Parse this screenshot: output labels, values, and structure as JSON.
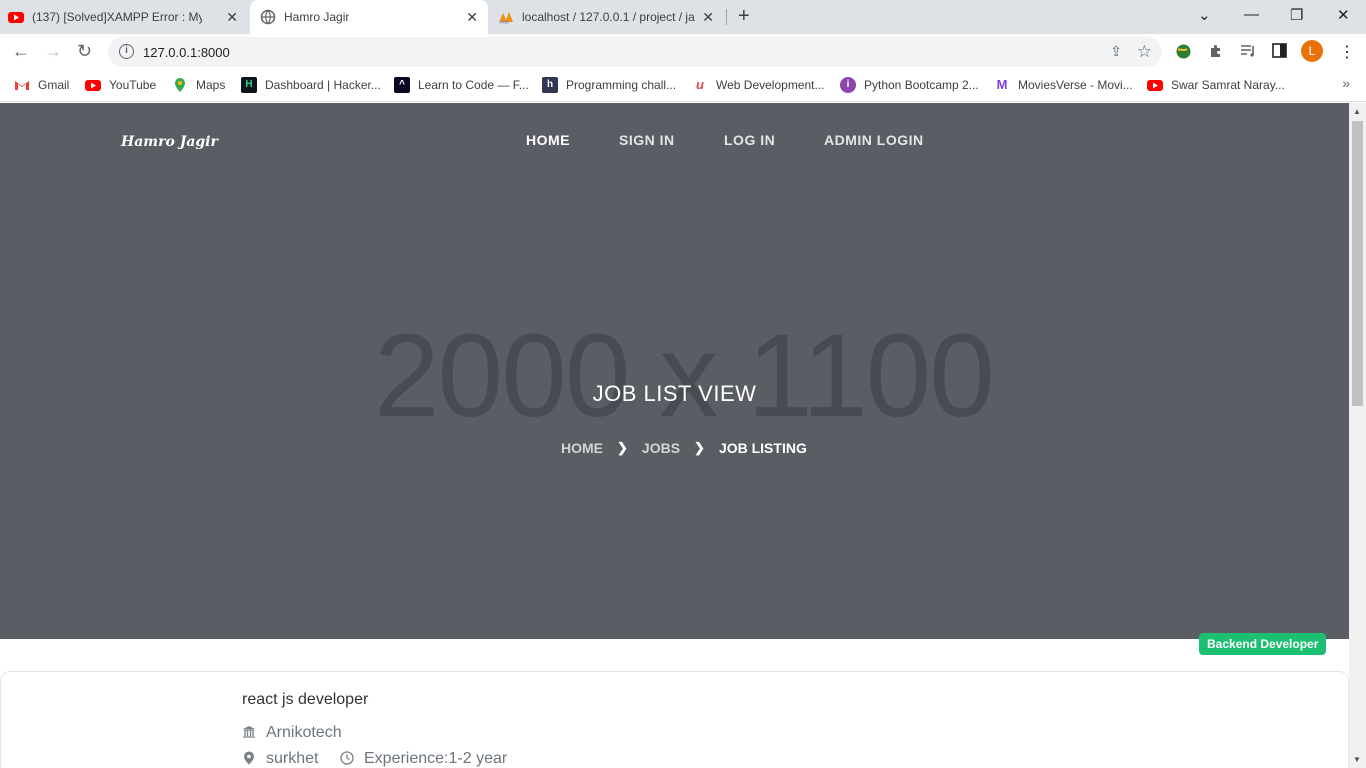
{
  "browser": {
    "tabs": [
      {
        "title": "(137) [Solved]XAMPP Error : MySQ",
        "icon": "youtube-icon"
      },
      {
        "title": "Hamro Jagir",
        "icon": "globe-icon"
      },
      {
        "title": "localhost / 127.0.0.1 / project / ja",
        "icon": "phpmyadmin-icon"
      }
    ],
    "url": "127.0.0.1:8000",
    "profile_initial": "L",
    "bookmarks": [
      {
        "label": "Gmail",
        "icon": "gmail-icon",
        "color": "#ea4335"
      },
      {
        "label": "YouTube",
        "icon": "youtube-icon",
        "color": "#ff0000"
      },
      {
        "label": "Maps",
        "icon": "maps-icon",
        "color": "#34a853"
      },
      {
        "label": "Dashboard | Hacker...",
        "icon": "hackerrank-icon",
        "color": "#0e141e"
      },
      {
        "label": "Learn to Code — F...",
        "icon": "freecodecamp-icon",
        "color": "#0a0a23"
      },
      {
        "label": "Programming chall...",
        "icon": "hackerearth-icon",
        "color": "#323754"
      },
      {
        "label": "Web Development...",
        "icon": "udemy-icon",
        "color": "#e0464f"
      },
      {
        "label": "Python Bootcamp 2...",
        "icon": "bootcamp-icon",
        "color": "#8e44ad"
      },
      {
        "label": "MoviesVerse - Movi...",
        "icon": "moviesverse-icon",
        "color": "#7b3fe4"
      },
      {
        "label": "Swar Samrat Naray...",
        "icon": "youtube-icon",
        "color": "#ff0000"
      }
    ]
  },
  "site": {
    "logo": "Hamro Jagir",
    "nav": [
      "HOME",
      "SIGN IN",
      "LOG IN",
      "ADMIN LOGIN"
    ],
    "hero_placeholder": "2000 x 1100",
    "hero_title": "JOB LIST VIEW",
    "breadcrumb": [
      "HOME",
      "JOBS",
      "JOB LISTING"
    ]
  },
  "job": {
    "title": "react js developer",
    "company": "Arnikotech",
    "location": "surkhet",
    "experience": "Experience:1-2 year",
    "category": "Backend Developer"
  },
  "colors": {
    "hero_bg": "#5a5d63",
    "badge": "#1dbf73",
    "profile": "#e8710a"
  }
}
